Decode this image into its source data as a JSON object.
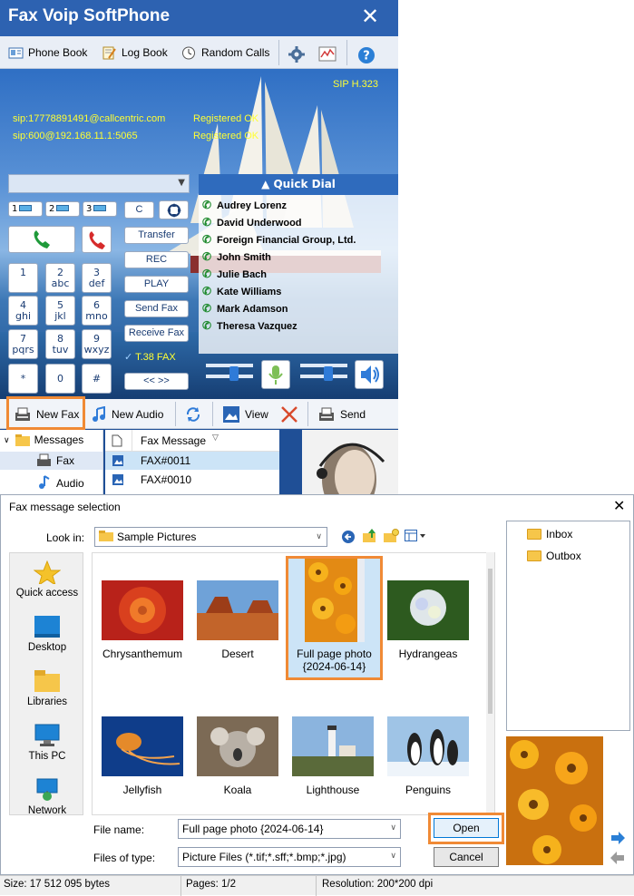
{
  "app": {
    "title": "Fax Voip SoftPhone",
    "close_glyph": "✕",
    "toolbar": {
      "phone_book": "Phone Book",
      "log_book": "Log Book",
      "random_calls": "Random Calls"
    },
    "protocols": "SIP  H.323",
    "accounts": [
      {
        "uri": "sip:17778891491@callcentric.com",
        "status": "Registered OK"
      },
      {
        "uri": "sip:600@192.168.11.1:5065",
        "status": "Registered OK"
      }
    ],
    "lines": [
      "1",
      "2",
      "3"
    ],
    "keypad": [
      {
        "d": "1",
        "l": ""
      },
      {
        "d": "2",
        "l": "abc"
      },
      {
        "d": "3",
        "l": "def"
      },
      {
        "d": "4",
        "l": "ghi"
      },
      {
        "d": "5",
        "l": "jkl"
      },
      {
        "d": "6",
        "l": "mno"
      },
      {
        "d": "7",
        "l": "pqrs"
      },
      {
        "d": "8",
        "l": "tuv"
      },
      {
        "d": "9",
        "l": "wxyz"
      },
      {
        "d": "*",
        "l": ""
      },
      {
        "d": "0",
        "l": ""
      },
      {
        "d": "#",
        "l": ""
      }
    ],
    "controls": {
      "c": "C",
      "transfer": "Transfer",
      "rec": "REC",
      "play": "PLAY",
      "send_fax": "Send Fax",
      "receive_fax": "Receive Fax",
      "t38": "T.38 FAX",
      "arrows": "<< >>"
    },
    "quick_dial": {
      "header": "Quick Dial",
      "contacts": [
        "Audrey Lorenz",
        "David Underwood",
        "Foreign Financial Group, Ltd.",
        "John Smith",
        "Julie Bach",
        "Kate Williams",
        "Mark Adamson",
        "Theresa Vazquez"
      ]
    },
    "actions": {
      "new_fax": "New Fax",
      "new_audio": "New Audio",
      "view": "View",
      "send": "Send"
    },
    "tree": {
      "root": "Messages",
      "items": [
        "Fax",
        "Audio"
      ]
    },
    "list": {
      "column": "Fax Message",
      "rows": [
        "FAX#0011",
        "FAX#0010"
      ]
    }
  },
  "dialog": {
    "title": "Fax message selection",
    "look_in_label": "Look in:",
    "look_in_value": "Sample Pictures",
    "places": [
      "Quick access",
      "Desktop",
      "Libraries",
      "This PC",
      "Network"
    ],
    "files": [
      {
        "name": "Chrysanthemum",
        "sub": ""
      },
      {
        "name": "Desert",
        "sub": ""
      },
      {
        "name": "Full page photo",
        "sub": "{2024-06-14}"
      },
      {
        "name": "Hydrangeas",
        "sub": ""
      },
      {
        "name": "Jellyfish",
        "sub": ""
      },
      {
        "name": "Koala",
        "sub": ""
      },
      {
        "name": "Lighthouse",
        "sub": ""
      },
      {
        "name": "Penguins",
        "sub": ""
      }
    ],
    "file_name_label": "File name:",
    "file_name_value": "Full page photo {2024-06-14}",
    "file_type_label": "Files of type:",
    "file_type_value": "Picture Files (*.tif;*.sff;*.bmp;*.jpg)",
    "open_label": "Open",
    "cancel_label": "Cancel",
    "folders": [
      "Inbox",
      "Outbox"
    ],
    "close_glyph": "✕"
  },
  "status": {
    "size": "Size: 17 512 095 bytes",
    "pages": "Pages: 1/2",
    "resolution": "Resolution: 200*200 dpi"
  },
  "colors": {
    "accent": "#2d62b1",
    "highlight": "#f08a35",
    "sip_text": "#ffff33"
  }
}
